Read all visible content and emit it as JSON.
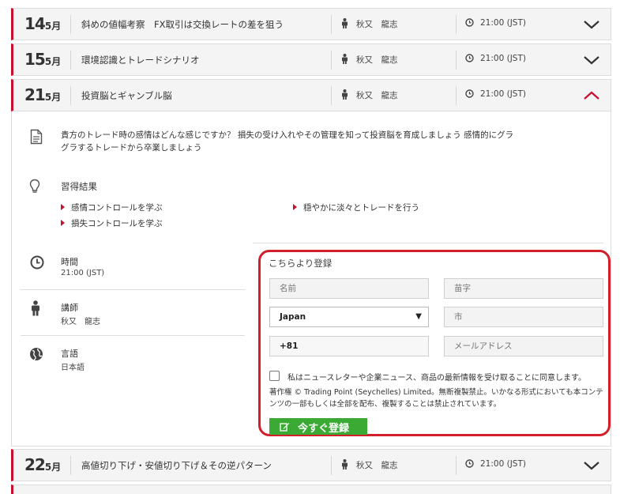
{
  "rows_top": [
    {
      "day": "14",
      "month": "5月",
      "title": "斜めの値幅考察　FX取引は交換レートの差を狙う",
      "speaker": "秋又　龍志",
      "time": "21:00 (JST)"
    },
    {
      "day": "15",
      "month": "5月",
      "title": "環境認識とトレードシナリオ",
      "speaker": "秋又　龍志",
      "time": "21:00 (JST)"
    },
    {
      "day": "21",
      "month": "5月",
      "title": "投資脳とギャンブル脳",
      "speaker": "秋又　龍志",
      "time": "21:00 (JST)"
    }
  ],
  "row_bottom": {
    "day": "22",
    "month": "5月",
    "title": "高値切り下げ・安値切り下げ＆その逆パターン",
    "speaker": "秋又　龍志",
    "time": "21:00 (JST)"
  },
  "detail": {
    "description": "貴方のトレード時の感情はどんな感じですか？ 損失の受け入れやその管理を知って投資脳を育成しましょう 感情的にグラグラするトレードから卒業しましょう",
    "learn_title": "習得結果",
    "learn_items": [
      "感情コントロールを学ぶ",
      "穏やかに淡々とトレードを行う",
      "損失コントロールを学ぶ"
    ],
    "time_label": "時間",
    "time_value": "21:00 (JST)",
    "speaker_label": "講師",
    "speaker_value": "秋又　龍志",
    "lang_label": "言語",
    "lang_value": "日本語"
  },
  "form": {
    "title": "こちらより登録",
    "first_name_placeholder": "名前",
    "last_name_placeholder": "苗字",
    "country_value": "Japan",
    "city_placeholder": "市",
    "phone_value": "+81",
    "email_placeholder": "メールアドレス",
    "consent": "私はニュースレターや企業ニュース、商品の最新情報を受け取ることに同意します。",
    "copyright": "著作権 © Trading Point (Seychelles) Limited。無断複製禁止。いかなる形式においても本コンテンツの一部もしくは全部を配布、複製することは禁止されています。",
    "submit_label": "今すぐ登録"
  },
  "colors": {
    "accent": "#c8102e",
    "submit": "#3aaa35",
    "highlight": "#d21f2c"
  },
  "icons": {
    "row_speaker": "person-icon",
    "row_time": "clock-icon",
    "collapsed": "chevron-down-icon",
    "expanded": "chevron-up-icon",
    "description": "document-icon",
    "learn": "lightbulb-icon",
    "language": "globe-icon",
    "submit": "edit-icon"
  }
}
